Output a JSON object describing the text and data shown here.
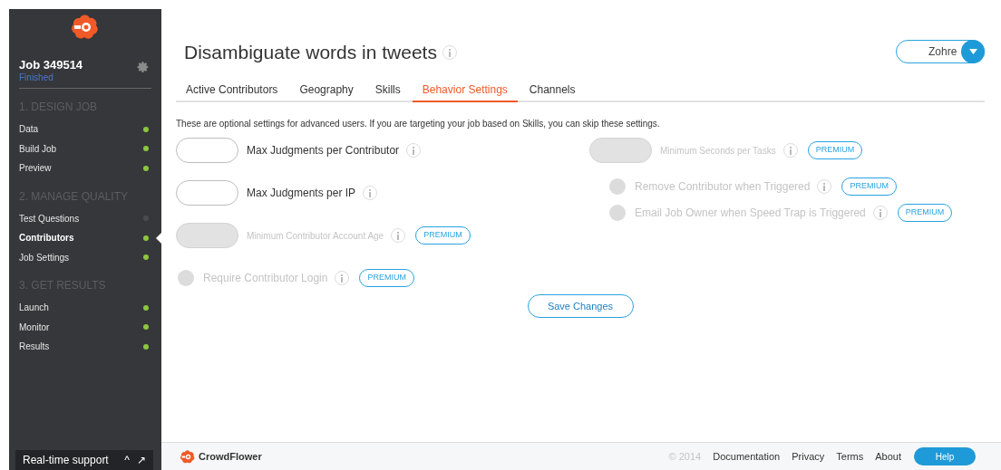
{
  "sidebar": {
    "job_title": "Job 349514",
    "job_status": "Finished",
    "sections": [
      {
        "heading": "1. DESIGN JOB",
        "items": [
          {
            "label": "Data",
            "done": true,
            "selected": false
          },
          {
            "label": "Build Job",
            "done": true,
            "selected": false
          },
          {
            "label": "Preview",
            "done": true,
            "selected": false
          }
        ]
      },
      {
        "heading": "2. MANAGE QUALITY",
        "items": [
          {
            "label": "Test Questions",
            "done": false,
            "selected": false
          },
          {
            "label": "Contributors",
            "done": true,
            "selected": true
          },
          {
            "label": "Job Settings",
            "done": true,
            "selected": false
          }
        ]
      },
      {
        "heading": "3. GET RESULTS",
        "items": [
          {
            "label": "Launch",
            "done": true,
            "selected": false
          },
          {
            "label": "Monitor",
            "done": true,
            "selected": false
          },
          {
            "label": "Results",
            "done": true,
            "selected": false
          }
        ]
      }
    ],
    "support": {
      "label": "Real-time support",
      "collapse": "^",
      "popout": "↗"
    }
  },
  "header": {
    "title": "Disambiguate words in tweets",
    "user": "Zohre"
  },
  "tabs": [
    {
      "label": "Active Contributors",
      "selected": false
    },
    {
      "label": "Geography",
      "selected": false
    },
    {
      "label": "Skills",
      "selected": false
    },
    {
      "label": "Behavior Settings",
      "selected": true
    },
    {
      "label": "Channels",
      "selected": false
    }
  ],
  "intro": "These are optional settings for advanced users. If you are targeting your job based on Skills, you can skip these settings.",
  "left_settings": [
    {
      "kind": "input",
      "label": "Max Judgments per Contributor",
      "disabled": false,
      "premium": false
    },
    {
      "kind": "input",
      "label": "Max Judgments per IP",
      "disabled": false,
      "premium": false
    },
    {
      "kind": "input",
      "label": "Minimum Contributor Account Age",
      "disabled": true,
      "premium": true,
      "badge": "PREMIUM"
    },
    {
      "kind": "radio",
      "label": "Require Contributor Login",
      "disabled": true,
      "premium": true,
      "badge": "PREMIUM"
    }
  ],
  "right_settings": [
    {
      "kind": "input",
      "label": "Minimum Seconds per Tasks",
      "disabled": true,
      "premium": true,
      "badge": "PREMIUM"
    },
    {
      "kind": "radio",
      "label": "Remove Contributor when Triggered",
      "disabled": true,
      "premium": true,
      "badge": "PREMIUM"
    },
    {
      "kind": "radio",
      "label": "Email Job Owner when Speed Trap is Triggered",
      "disabled": true,
      "premium": true,
      "badge": "PREMIUM"
    }
  ],
  "save_button": "Save Changes",
  "footer": {
    "brand": "CrowdFlower",
    "copyright": "© 2014",
    "links": [
      "Documentation",
      "Privacy",
      "Terms",
      "About"
    ],
    "help": "Help"
  }
}
